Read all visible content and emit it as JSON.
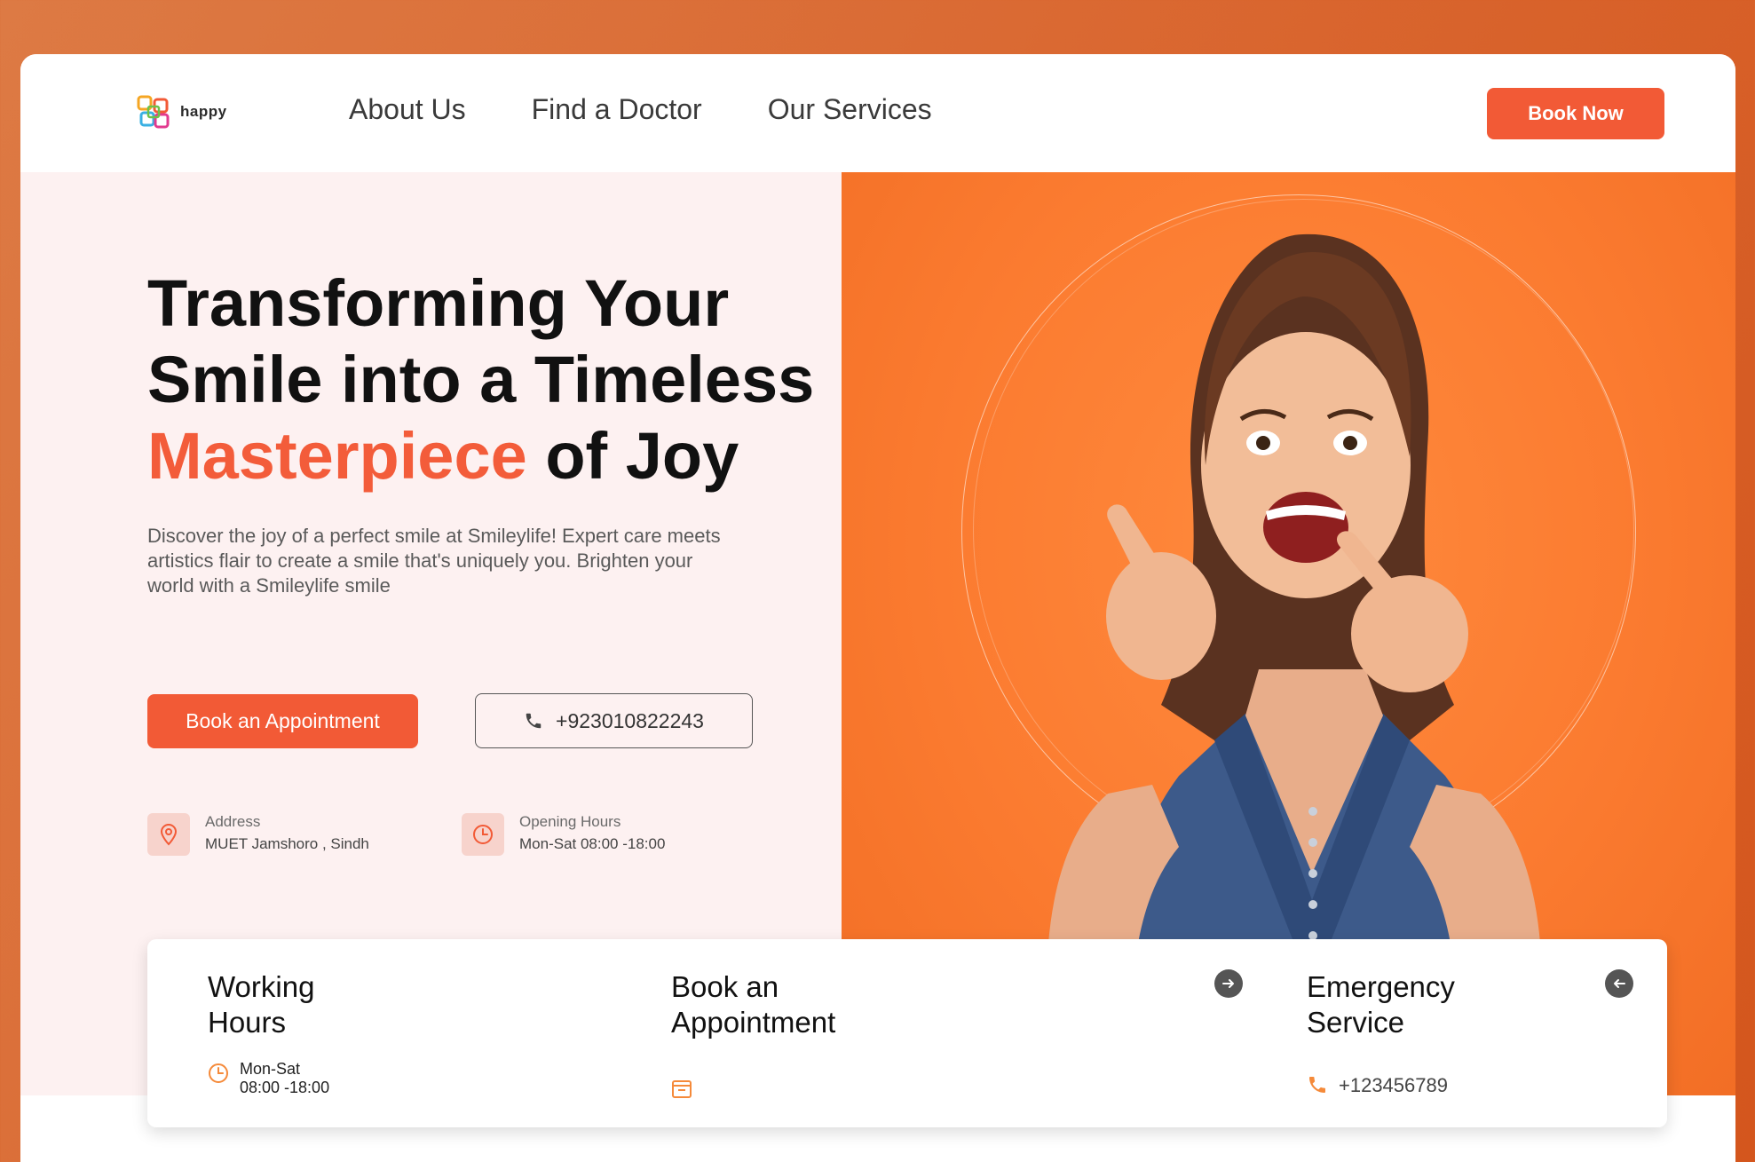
{
  "brand": {
    "name": "happy"
  },
  "nav": {
    "links": [
      "About Us",
      "Find a Doctor",
      "Our Services"
    ],
    "cta": "Book Now"
  },
  "hero": {
    "title_line1": "Transforming Your",
    "title_line2": "Smile into a Timeless",
    "title_accent": "Masterpiece",
    "title_tail": " of Joy",
    "description": "Discover the joy of a perfect smile at Smileylife! Expert care meets artistics flair to create a smile that's uniquely you. Brighten your world with a Smileylife smile",
    "primary_button": "Book an Appointment",
    "phone": "+923010822243",
    "address_label": "Address",
    "address_value": "MUET Jamshoro , Sindh",
    "hours_label": "Opening Hours",
    "hours_value": "Mon-Sat 08:00 -18:00"
  },
  "cards": {
    "working": {
      "title": "Working\nHours",
      "line1": "Mon-Sat",
      "line2": "08:00 -18:00"
    },
    "appointment": {
      "title": "Book an\nAppointment"
    },
    "emergency": {
      "title": "Emergency\nService",
      "phone": "+123456789"
    }
  },
  "colors": {
    "accent": "#f25a36",
    "hero_orange": "#fb7b30",
    "hero_left_bg": "#fdf1f1",
    "page_bg": "#d9652e"
  },
  "icons": {
    "logo": "logo-icon",
    "phone": "phone-icon",
    "address": "location-pin-icon",
    "hours": "clock-icon",
    "calendar": "calendar-icon",
    "arrow_right": "arrow-right-icon",
    "arrow_left": "arrow-left-icon"
  }
}
